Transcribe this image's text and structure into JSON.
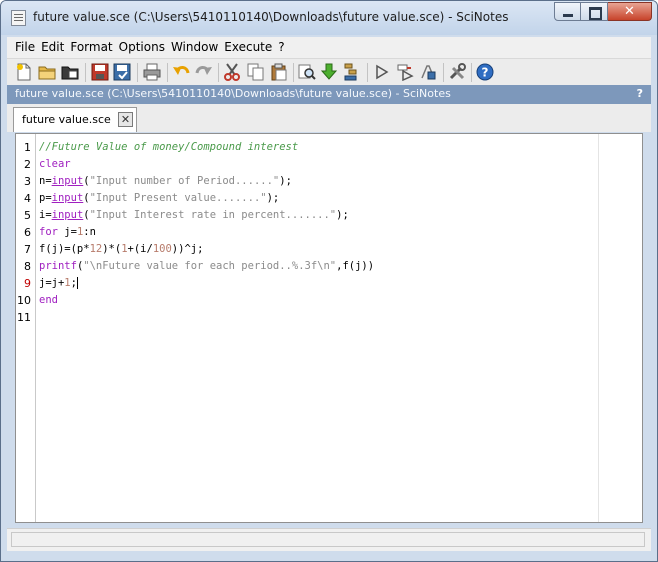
{
  "window": {
    "title": "future value.sce (C:\\Users\\5410110140\\Downloads\\future value.sce) - SciNotes",
    "close_glyph": "✕"
  },
  "menu": [
    "File",
    "Edit",
    "Format",
    "Options",
    "Window",
    "Execute",
    "?"
  ],
  "toolbar_icons": [
    "new-file-icon",
    "open-folder-icon",
    "open-file-icon",
    "save-icon",
    "save-as-icon",
    "print-icon",
    "undo-icon",
    "redo-icon",
    "cut-icon",
    "copy-icon",
    "paste-icon",
    "find-icon",
    "execute-file-icon",
    "execute-selection-icon",
    "run-icon",
    "run-until-icon",
    "stop-icon",
    "settings-icon",
    "help-icon"
  ],
  "document_bar": {
    "title": "future value.sce (C:\\Users\\5410110140\\Downloads\\future value.sce) - SciNotes",
    "help": "?"
  },
  "tab": {
    "label": "future value.sce",
    "close": "✕"
  },
  "editor": {
    "current_line": 9,
    "lines": [
      {
        "num": "1",
        "tokens": [
          {
            "t": "cm",
            "v": "//Future Value of money/Compound interest"
          }
        ]
      },
      {
        "num": "2",
        "tokens": [
          {
            "t": "kw",
            "v": "clear"
          }
        ]
      },
      {
        "num": "3",
        "tokens": [
          {
            "t": "vr",
            "v": "n="
          },
          {
            "t": "fn",
            "v": "input"
          },
          {
            "t": "op",
            "v": "("
          },
          {
            "t": "st",
            "v": "\"Input number of Period......\""
          },
          {
            "t": "op",
            "v": ");"
          }
        ]
      },
      {
        "num": "4",
        "tokens": [
          {
            "t": "vr",
            "v": "p="
          },
          {
            "t": "fn",
            "v": "input"
          },
          {
            "t": "op",
            "v": "("
          },
          {
            "t": "st",
            "v": "\"Input Present value.......\""
          },
          {
            "t": "op",
            "v": ");"
          }
        ]
      },
      {
        "num": "5",
        "tokens": [
          {
            "t": "vr",
            "v": "i="
          },
          {
            "t": "fn",
            "v": "input"
          },
          {
            "t": "op",
            "v": "("
          },
          {
            "t": "st",
            "v": "\"Input Interest rate in percent.......\""
          },
          {
            "t": "op",
            "v": ");"
          }
        ]
      },
      {
        "num": "6",
        "tokens": [
          {
            "t": "kw",
            "v": "for"
          },
          {
            "t": "vr",
            "v": " j="
          },
          {
            "t": "nm",
            "v": "1"
          },
          {
            "t": "op",
            "v": ":"
          },
          {
            "t": "vr",
            "v": "n"
          }
        ]
      },
      {
        "num": "7",
        "tokens": [
          {
            "t": "vr",
            "v": "f(j)=(p*"
          },
          {
            "t": "nm",
            "v": "12"
          },
          {
            "t": "vr",
            "v": ")*("
          },
          {
            "t": "nm",
            "v": "1"
          },
          {
            "t": "vr",
            "v": "+(i/"
          },
          {
            "t": "nm",
            "v": "100"
          },
          {
            "t": "vr",
            "v": "))^j;"
          }
        ]
      },
      {
        "num": "8",
        "tokens": [
          {
            "t": "kw",
            "v": "printf"
          },
          {
            "t": "op",
            "v": "("
          },
          {
            "t": "st",
            "v": "\"\\nFuture value for each period..%.3f\\n\""
          },
          {
            "t": "op",
            "v": ",f(j))"
          }
        ]
      },
      {
        "num": "9",
        "tokens": [
          {
            "t": "vr",
            "v": "j=j+"
          },
          {
            "t": "nm",
            "v": "1"
          },
          {
            "t": "vr",
            "v": ";"
          }
        ]
      },
      {
        "num": "10",
        "tokens": [
          {
            "t": "kw",
            "v": "end"
          }
        ]
      },
      {
        "num": "11",
        "tokens": []
      }
    ]
  },
  "status": {
    "text": ""
  }
}
